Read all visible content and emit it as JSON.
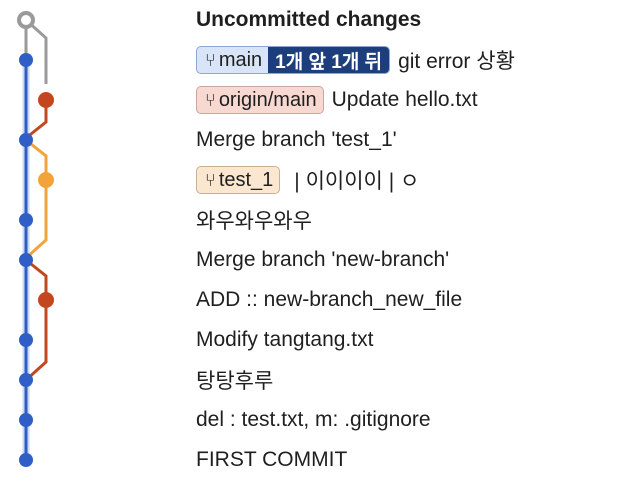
{
  "colors": {
    "main_lane": "#2f5fc4",
    "origin_lane": "#c2471f",
    "test_lane": "#f2a43a",
    "uncommitted": "#9a9a9a"
  },
  "graph": {
    "uncommitted_node": "hollow",
    "nodes": [
      {
        "lane": "uncommitted"
      },
      {
        "lane": "main"
      },
      {
        "lane": "origin"
      },
      {
        "lane": "main"
      },
      {
        "lane": "test"
      },
      {
        "lane": "main"
      },
      {
        "lane": "main"
      },
      {
        "lane": "origin"
      },
      {
        "lane": "main"
      },
      {
        "lane": "main"
      },
      {
        "lane": "main"
      },
      {
        "lane": "main"
      }
    ]
  },
  "commits": [
    {
      "message": "Uncommitted changes",
      "bold": true
    },
    {
      "branch": "main",
      "branch_icon": "branch-icon",
      "ahead_behind": "1개 앞 1개 뒤",
      "message": "git error 상황"
    },
    {
      "branch": "origin/main",
      "branch_icon": "branch-icon",
      "message": "Update hello.txt"
    },
    {
      "message": "Merge branch 'test_1'"
    },
    {
      "branch": "test_1",
      "branch_icon": "branch-icon",
      "message": "| 이이이이 | ㅇ"
    },
    {
      "message": "와우와우와우"
    },
    {
      "message": "Merge branch 'new-branch'"
    },
    {
      "message": "ADD :: new-branch_new_file"
    },
    {
      "message": "Modify tangtang.txt"
    },
    {
      "message": "탕탕후루"
    },
    {
      "message": "del : test.txt, m: .gitignore"
    },
    {
      "message": "FIRST COMMIT"
    }
  ]
}
